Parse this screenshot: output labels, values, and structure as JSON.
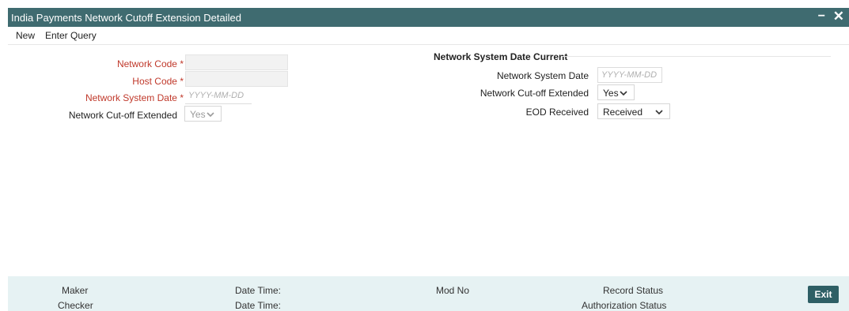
{
  "window": {
    "title": "India Payments Network Cutoff Extension Detailed",
    "minimize_glyph": "−",
    "close_glyph": "✕"
  },
  "menu": {
    "new_label": "New",
    "enter_query_label": "Enter Query"
  },
  "left_form": {
    "network_code_label": "Network Code",
    "host_code_label": "Host Code",
    "network_system_date_label": "Network System Date",
    "network_system_date_placeholder": "YYYY-MM-DD",
    "network_cutoff_extended_label": "Network Cut-off Extended",
    "network_cutoff_extended_value": "Yes",
    "required_mark": "*"
  },
  "right_section": {
    "heading": "Network System Date Current",
    "network_system_date_label": "Network System Date",
    "network_system_date_placeholder": "YYYY-MM-DD",
    "network_cutoff_extended_label": "Network Cut-off Extended",
    "network_cutoff_extended_value": "Yes",
    "eod_received_label": "EOD Received",
    "eod_received_value": "Received"
  },
  "footer": {
    "maker_label": "Maker",
    "checker_label": "Checker",
    "date_time_label_1": "Date Time:",
    "date_time_label_2": "Date Time:",
    "mod_no_label": "Mod No",
    "record_status_label": "Record Status",
    "authorization_status_label": "Authorization Status",
    "exit_label": "Exit"
  },
  "colors": {
    "titlebar": "#3f6b70",
    "required_label": "#c0392b",
    "footer_bg": "#e6f2f3",
    "exit_button": "#2e5f65"
  }
}
